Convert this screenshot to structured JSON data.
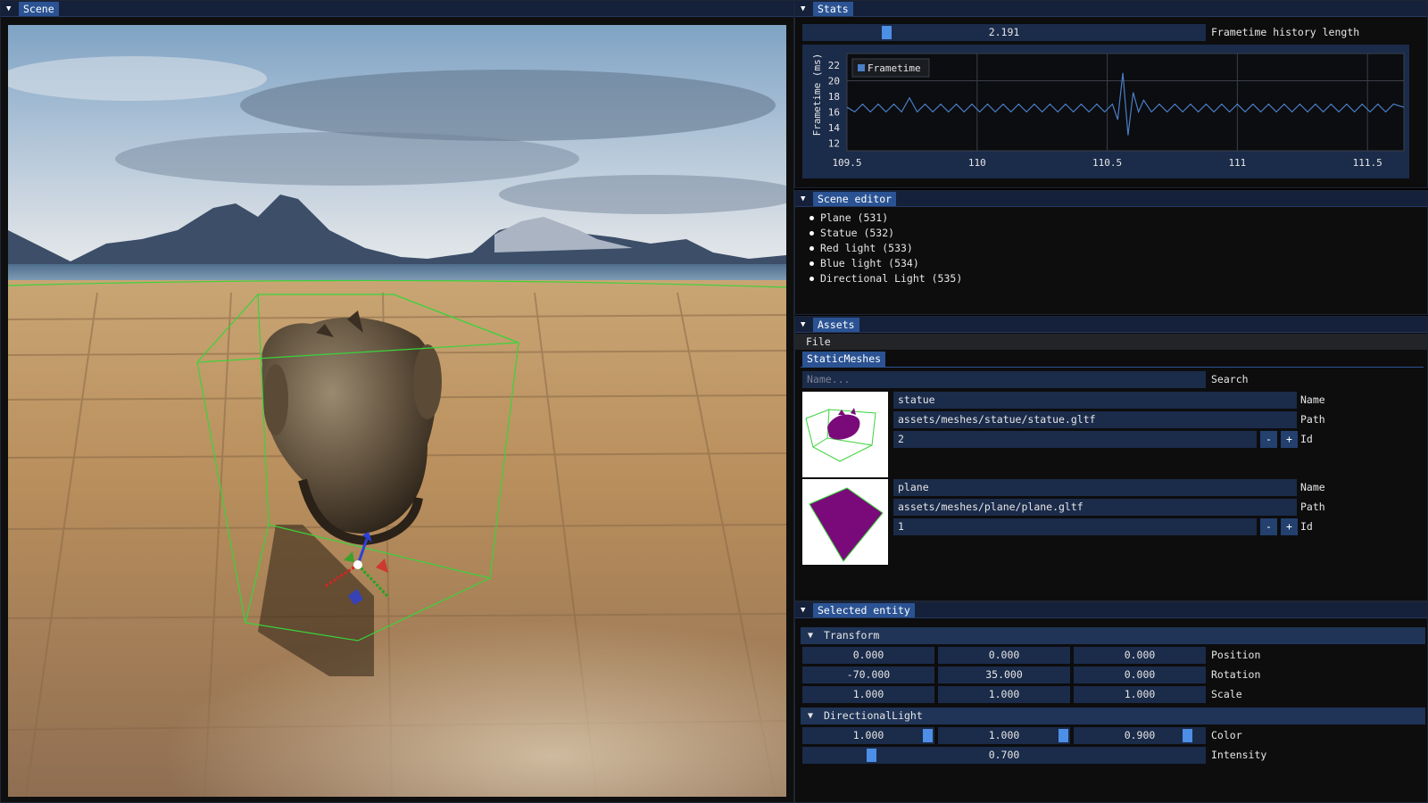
{
  "scene": {
    "title": "Scene"
  },
  "stats": {
    "title": "Stats",
    "history_value": "2.191",
    "history_fraction": 0.2,
    "history_label": "Frametime history length"
  },
  "chart_data": {
    "type": "line",
    "title": "",
    "xlabel": "",
    "ylabel": "Frametime (ms)",
    "legend": "top-left",
    "grid": true,
    "xlim": [
      109.5,
      111.64
    ],
    "ylim": [
      11,
      23.5
    ],
    "x_ticks": [
      "109.5",
      "110",
      "110.5",
      "111",
      "111.5"
    ],
    "y_ticks": [
      "12",
      "14",
      "16",
      "18",
      "20",
      "22"
    ],
    "series": [
      {
        "name": "Frametime",
        "color": "#4a7ec8",
        "x": [
          109.5,
          109.53,
          109.56,
          109.59,
          109.62,
          109.65,
          109.68,
          109.71,
          109.74,
          109.77,
          109.8,
          109.83,
          109.86,
          109.89,
          109.92,
          109.95,
          109.98,
          110.01,
          110.04,
          110.07,
          110.1,
          110.13,
          110.16,
          110.19,
          110.22,
          110.25,
          110.28,
          110.31,
          110.34,
          110.37,
          110.4,
          110.43,
          110.46,
          110.49,
          110.52,
          110.54,
          110.56,
          110.58,
          110.6,
          110.62,
          110.64,
          110.67,
          110.7,
          110.73,
          110.76,
          110.79,
          110.82,
          110.85,
          110.88,
          110.91,
          110.94,
          110.97,
          111.0,
          111.03,
          111.06,
          111.09,
          111.12,
          111.15,
          111.18,
          111.21,
          111.24,
          111.27,
          111.3,
          111.33,
          111.36,
          111.39,
          111.42,
          111.45,
          111.48,
          111.51,
          111.54,
          111.57,
          111.6,
          111.64
        ],
        "values": [
          16.6,
          16.0,
          17.0,
          16.0,
          17.0,
          16.0,
          17.0,
          16.0,
          17.8,
          16.0,
          17.0,
          16.0,
          17.0,
          16.0,
          17.0,
          16.0,
          17.0,
          16.0,
          17.0,
          16.0,
          17.0,
          16.0,
          17.0,
          16.0,
          17.0,
          16.0,
          17.0,
          16.0,
          17.0,
          16.0,
          17.0,
          16.0,
          17.0,
          16.0,
          17.0,
          15.0,
          21.0,
          13.0,
          18.5,
          16.0,
          17.5,
          16.0,
          17.0,
          16.0,
          17.0,
          16.0,
          17.0,
          16.0,
          17.0,
          16.0,
          17.0,
          16.0,
          17.0,
          16.0,
          17.0,
          16.0,
          17.0,
          16.0,
          17.0,
          16.0,
          17.0,
          16.0,
          17.0,
          16.0,
          17.0,
          16.0,
          17.0,
          16.0,
          17.0,
          16.0,
          17.0,
          16.0,
          17.0,
          16.6
        ]
      }
    ]
  },
  "scene_editor": {
    "title": "Scene editor",
    "entities": [
      {
        "label": "Plane (531)"
      },
      {
        "label": "Statue (532)"
      },
      {
        "label": "Red light (533)"
      },
      {
        "label": "Blue light (534)"
      },
      {
        "label": "Directional Light (535)"
      }
    ]
  },
  "assets": {
    "title": "Assets",
    "menu_file": "File",
    "tab": "StaticMeshes",
    "search_placeholder": "Name...",
    "search_label": "Search",
    "name_label": "Name",
    "path_label": "Path",
    "id_label": "Id",
    "minus": "-",
    "plus": "+",
    "meshes": [
      {
        "name": "statue",
        "path": "assets/meshes/statue/statue.gltf",
        "id": "2"
      },
      {
        "name": "plane",
        "path": "assets/meshes/plane/plane.gltf",
        "id": "1"
      }
    ]
  },
  "selected": {
    "title": "Selected entity",
    "transform_header": "Transform",
    "position": {
      "label": "Position",
      "values": [
        "0.000",
        "0.000",
        "0.000"
      ]
    },
    "rotation": {
      "label": "Rotation",
      "values": [
        "-70.000",
        "35.000",
        "0.000"
      ]
    },
    "scale": {
      "label": "Scale",
      "values": [
        "1.000",
        "1.000",
        "1.000"
      ]
    },
    "light_header": "DirectionalLight",
    "color": {
      "label": "Color",
      "values": [
        "1.000",
        "1.000",
        "0.900"
      ],
      "fractions": [
        1.0,
        1.0,
        0.9
      ]
    },
    "intensity": {
      "label": "Intensity",
      "value": "0.700",
      "fraction": 0.16
    }
  },
  "colors": {
    "accent": "#2b5393",
    "frame_bg": "#1b2b4a",
    "grab": "#4d8ee6",
    "bbox": "#3ad33a",
    "mesh_purple": "#7a0a7a"
  }
}
